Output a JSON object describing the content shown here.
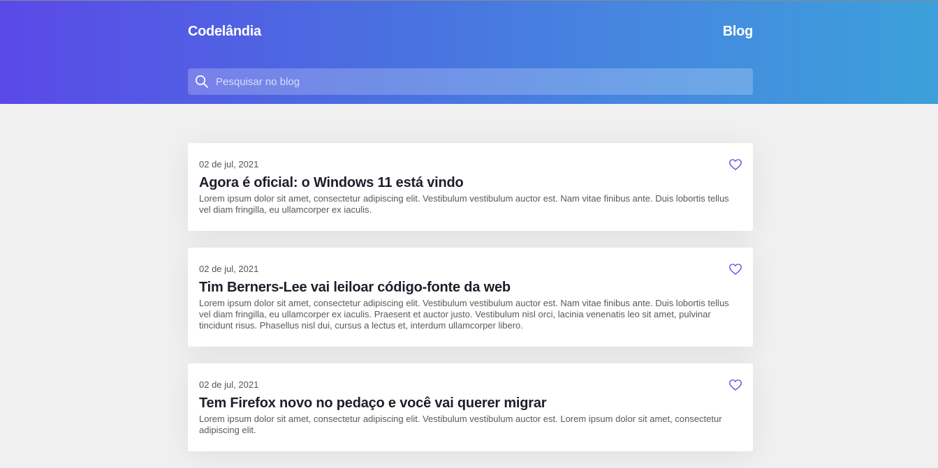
{
  "header": {
    "brand": "Codelândia",
    "nav_link": "Blog",
    "search_placeholder": "Pesquisar no blog"
  },
  "posts": [
    {
      "date": "02 de jul, 2021",
      "title": "Agora é oficial: o Windows 11 está vindo",
      "excerpt": "Lorem ipsum dolor sit amet, consectetur adipiscing elit. Vestibulum vestibulum auctor est. Nam vitae finibus ante. Duis lobortis tellus vel diam fringilla, eu ullamcorper ex iaculis."
    },
    {
      "date": "02 de jul, 2021",
      "title": "Tim Berners-Lee vai leiloar código-fonte da web",
      "excerpt": "Lorem ipsum dolor sit amet, consectetur adipiscing elit. Vestibulum vestibulum auctor est. Nam vitae finibus ante. Duis lobortis tellus vel diam fringilla, eu ullamcorper ex iaculis. Praesent et auctor justo. Vestibulum nisl orci, lacinia venenatis leo sit amet, pulvinar tincidunt risus. Phasellus nisl dui, cursus a lectus et, interdum ullamcorper libero."
    },
    {
      "date": "02 de jul, 2021",
      "title": "Tem Firefox novo no pedaço e você vai querer migrar",
      "excerpt": "Lorem ipsum dolor sit amet, consectetur adipiscing elit. Vestibulum vestibulum auctor est. Lorem ipsum dolor sit amet, consectetur adipiscing elit."
    }
  ],
  "icons": {
    "search": "search-icon",
    "like": "heart-icon"
  },
  "colors": {
    "header_gradient_start": "#5a49e8",
    "header_gradient_end": "#3ca0da",
    "heart": "#5a49e8",
    "page_background": "#f0f0f0"
  }
}
